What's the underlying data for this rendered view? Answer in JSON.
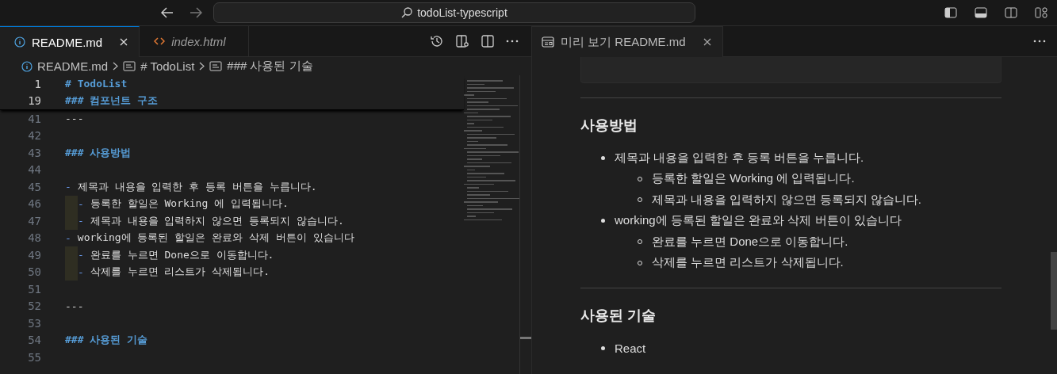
{
  "titlebar": {
    "search": "todoList-typescript"
  },
  "editor": {
    "tabs": [
      {
        "label": "README.md",
        "kind": "info",
        "italic": false,
        "selected": true
      },
      {
        "label": "index.html",
        "kind": "code",
        "italic": true,
        "selected": false
      }
    ],
    "breadcrumb": [
      "README.md",
      "# TodoList",
      "### 사용된 기술"
    ],
    "sticky": [
      {
        "number": "1",
        "text": "# TodoList",
        "kind": "heading"
      },
      {
        "number": "19",
        "text": "### 컴포넌트 구조",
        "kind": "heading"
      }
    ],
    "lines": [
      {
        "number": "41",
        "text": "---",
        "kind": "plain"
      },
      {
        "number": "42",
        "kind": "plain"
      },
      {
        "number": "43",
        "text": "### 사용방법",
        "kind": "heading"
      },
      {
        "number": "44",
        "kind": "plain"
      },
      {
        "number": "45",
        "marker": "-",
        "text": "제목과 내용을 입력한 후 등록 버튼을 누릅니다.",
        "kind": "bullet"
      },
      {
        "number": "46",
        "marker": "-",
        "text": "등록한 할일은 Working 에 입력됩니다.",
        "kind": "subbullet"
      },
      {
        "number": "47",
        "marker": "-",
        "text": "제목과 내용을 입력하지 않으면 등록되지 않습니다.",
        "kind": "subbullet"
      },
      {
        "number": "48",
        "marker": "-",
        "text": "working에 등록된 할일은 완료와 삭제 버튼이 있습니다",
        "kind": "bullet"
      },
      {
        "number": "49",
        "marker": "-",
        "text": "완료를 누르면 Done으로 이동합니다.",
        "kind": "subbullet"
      },
      {
        "number": "50",
        "marker": "-",
        "text": "삭제를 누르면 리스트가 삭제됩니다.",
        "kind": "subbullet"
      },
      {
        "number": "51",
        "kind": "plain"
      },
      {
        "number": "52",
        "text": "---",
        "kind": "plain"
      },
      {
        "number": "53",
        "kind": "plain"
      },
      {
        "number": "54",
        "text": "### 사용된 기술",
        "kind": "heading"
      },
      {
        "number": "55",
        "kind": "plain"
      }
    ]
  },
  "preview": {
    "tab": "미리 보기 README.md",
    "sections": [
      {
        "heading": "사용방법",
        "items": [
          {
            "text": "제목과 내용을 입력한 후 등록 버튼을 누릅니다.",
            "children": [
              {
                "text": "등록한 할일은 Working 에 입력됩니다."
              },
              {
                "text": "제목과 내용을 입력하지 않으면 등록되지 않습니다."
              }
            ]
          },
          {
            "text": "working에 등록된 할일은 완료와 삭제 버튼이 있습니다",
            "children": [
              {
                "text": "완료를 누르면 Done으로 이동합니다."
              },
              {
                "text": "삭제를 누르면 리스트가 삭제됩니다."
              }
            ]
          }
        ]
      },
      {
        "heading": "사용된 기술",
        "items": [
          {
            "text": "React"
          }
        ]
      }
    ]
  }
}
